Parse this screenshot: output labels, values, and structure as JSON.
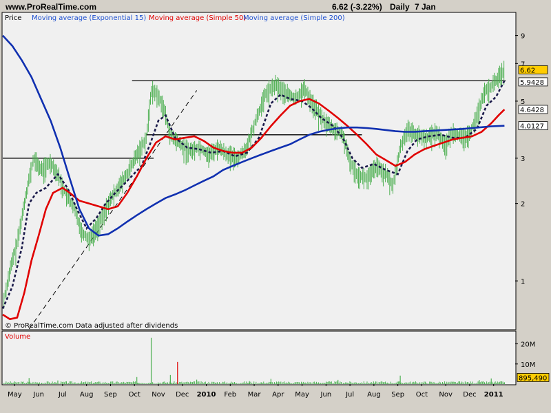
{
  "header": {
    "site": "www.ProRealTime.com",
    "quote": "6.62 (-3.22%)",
    "period": "Daily",
    "date": "7 Jan"
  },
  "legend": {
    "price": "Price",
    "ema": "Moving average (Exponential 15)",
    "sma50": "Moving average (Simple 50)",
    "sma200": "Moving average (Simple 200)"
  },
  "footnote": "© ProRealTime.com  Data adjusted after dividends",
  "volume_label": "Volume",
  "colors": {
    "background": "#d4d0c8",
    "plot_bg": "#f0f0f0",
    "price_bars": "#4caf50",
    "ema": "#1a1a4a",
    "sma50": "#e00000",
    "sma200": "#1030b0",
    "legend_ema": "#1e50d0",
    "label_bg_price": "#ffcc00",
    "label_box_border": "#000000"
  },
  "chart_data": [
    {
      "type": "line",
      "scale": "log",
      "ylim": [
        0.65,
        11
      ],
      "y_ticks": [
        1,
        2,
        3,
        5,
        7,
        9
      ],
      "grid": false,
      "x_labels": [
        "May",
        "Jun",
        "Jul",
        "Aug",
        "Sep",
        "Oct",
        "Nov",
        "Dec",
        "2010",
        "Feb",
        "Mar",
        "Apr",
        "May",
        "Jun",
        "Jul",
        "Aug",
        "Sep",
        "Oct",
        "Nov",
        "Dec",
        "2011"
      ],
      "x_positions": [
        0.5,
        1.5,
        2.5,
        3.5,
        4.5,
        5.5,
        6.5,
        7.5,
        8.5,
        9.5,
        10.5,
        11.5,
        12.5,
        13.5,
        14.5,
        15.5,
        16.5,
        17.5,
        18.5,
        19.5,
        20.5
      ],
      "x_max": 21.4,
      "series": [
        {
          "name": "Price",
          "role": "price",
          "values": [
            [
              0,
              0.8
            ],
            [
              0.3,
              1.1
            ],
            [
              0.6,
              1.4
            ],
            [
              0.9,
              2.0
            ],
            [
              1.1,
              2.5
            ],
            [
              1.3,
              3.0
            ],
            [
              1.6,
              2.7
            ],
            [
              2.0,
              2.9
            ],
            [
              2.3,
              2.6
            ],
            [
              2.6,
              2.2
            ],
            [
              3.0,
              1.9
            ],
            [
              3.3,
              1.55
            ],
            [
              3.6,
              1.45
            ],
            [
              4.0,
              1.65
            ],
            [
              4.4,
              2.0
            ],
            [
              4.8,
              2.3
            ],
            [
              5.2,
              2.6
            ],
            [
              5.6,
              3.1
            ],
            [
              6.0,
              3.6
            ],
            [
              6.2,
              5.5
            ],
            [
              6.4,
              5.4
            ],
            [
              6.7,
              4.8
            ],
            [
              7.0,
              3.7
            ],
            [
              7.4,
              3.4
            ],
            [
              7.8,
              3.2
            ],
            [
              8.2,
              3.3
            ],
            [
              8.6,
              3.1
            ],
            [
              9.0,
              3.3
            ],
            [
              9.4,
              3.1
            ],
            [
              9.8,
              3.0
            ],
            [
              10.2,
              3.3
            ],
            [
              10.6,
              4.3
            ],
            [
              11.0,
              5.4
            ],
            [
              11.4,
              5.8
            ],
            [
              11.8,
              5.4
            ],
            [
              12.2,
              5.1
            ],
            [
              12.6,
              5.6
            ],
            [
              13.0,
              4.8
            ],
            [
              13.4,
              4.2
            ],
            [
              13.8,
              3.9
            ],
            [
              14.2,
              3.7
            ],
            [
              14.5,
              2.9
            ],
            [
              14.8,
              2.6
            ],
            [
              15.2,
              2.5
            ],
            [
              15.6,
              2.8
            ],
            [
              16.0,
              2.6
            ],
            [
              16.3,
              2.35
            ],
            [
              16.6,
              3.3
            ],
            [
              16.9,
              3.9
            ],
            [
              17.3,
              3.7
            ],
            [
              17.7,
              3.6
            ],
            [
              18.1,
              3.8
            ],
            [
              18.5,
              3.4
            ],
            [
              18.8,
              3.8
            ],
            [
              19.2,
              3.6
            ],
            [
              19.5,
              3.7
            ],
            [
              19.8,
              4.4
            ],
            [
              20.1,
              5.4
            ],
            [
              20.4,
              5.7
            ],
            [
              20.7,
              6.2
            ],
            [
              20.95,
              6.62
            ]
          ]
        },
        {
          "name": "Moving average (Exponential 15)",
          "role": "ema",
          "values": [
            [
              0,
              0.78
            ],
            [
              0.4,
              0.95
            ],
            [
              0.8,
              1.35
            ],
            [
              1.1,
              2.0
            ],
            [
              1.4,
              2.2
            ],
            [
              1.8,
              2.3
            ],
            [
              2.3,
              2.6
            ],
            [
              2.7,
              2.3
            ],
            [
              3.1,
              1.9
            ],
            [
              3.5,
              1.6
            ],
            [
              3.9,
              1.75
            ],
            [
              4.3,
              2.0
            ],
            [
              4.7,
              2.2
            ],
            [
              5.2,
              2.45
            ],
            [
              5.8,
              2.8
            ],
            [
              6.2,
              3.5
            ],
            [
              6.5,
              4.2
            ],
            [
              6.8,
              4.4
            ],
            [
              7.2,
              3.6
            ],
            [
              7.7,
              3.3
            ],
            [
              8.2,
              3.25
            ],
            [
              8.7,
              3.15
            ],
            [
              9.2,
              3.2
            ],
            [
              9.7,
              3.05
            ],
            [
              10.2,
              3.15
            ],
            [
              10.7,
              3.6
            ],
            [
              11.2,
              4.9
            ],
            [
              11.6,
              5.3
            ],
            [
              12.0,
              5.1
            ],
            [
              12.5,
              5.0
            ],
            [
              12.9,
              4.7
            ],
            [
              13.3,
              4.3
            ],
            [
              13.8,
              4.0
            ],
            [
              14.2,
              3.6
            ],
            [
              14.6,
              3.0
            ],
            [
              15.0,
              2.75
            ],
            [
              15.5,
              2.85
            ],
            [
              16.0,
              2.7
            ],
            [
              16.5,
              2.6
            ],
            [
              16.9,
              3.2
            ],
            [
              17.3,
              3.55
            ],
            [
              17.8,
              3.65
            ],
            [
              18.3,
              3.7
            ],
            [
              18.8,
              3.6
            ],
            [
              19.3,
              3.6
            ],
            [
              19.8,
              3.9
            ],
            [
              20.2,
              4.8
            ],
            [
              20.6,
              5.2
            ],
            [
              20.95,
              6.0
            ]
          ]
        },
        {
          "name": "Moving average (Simple 50)",
          "role": "sma50",
          "values": [
            [
              0,
              0.74
            ],
            [
              0.3,
              0.71
            ],
            [
              0.6,
              0.72
            ],
            [
              0.9,
              0.9
            ],
            [
              1.2,
              1.2
            ],
            [
              1.5,
              1.5
            ],
            [
              1.8,
              1.9
            ],
            [
              2.1,
              2.2
            ],
            [
              2.5,
              2.3
            ],
            [
              2.8,
              2.2
            ],
            [
              3.2,
              2.05
            ],
            [
              3.6,
              2.0
            ],
            [
              4.0,
              1.95
            ],
            [
              4.4,
              1.9
            ],
            [
              4.8,
              1.95
            ],
            [
              5.2,
              2.2
            ],
            [
              5.6,
              2.55
            ],
            [
              6.0,
              3.0
            ],
            [
              6.4,
              3.45
            ],
            [
              6.8,
              3.65
            ],
            [
              7.2,
              3.55
            ],
            [
              7.6,
              3.6
            ],
            [
              8.0,
              3.65
            ],
            [
              8.4,
              3.5
            ],
            [
              8.8,
              3.3
            ],
            [
              9.2,
              3.2
            ],
            [
              9.6,
              3.15
            ],
            [
              10.0,
              3.15
            ],
            [
              10.4,
              3.3
            ],
            [
              10.8,
              3.6
            ],
            [
              11.2,
              4.0
            ],
            [
              11.6,
              4.4
            ],
            [
              12.0,
              4.8
            ],
            [
              12.4,
              5.0
            ],
            [
              12.8,
              5.1
            ],
            [
              13.2,
              4.9
            ],
            [
              13.6,
              4.6
            ],
            [
              14.0,
              4.3
            ],
            [
              14.4,
              4.0
            ],
            [
              14.8,
              3.7
            ],
            [
              15.2,
              3.4
            ],
            [
              15.6,
              3.1
            ],
            [
              16.0,
              2.95
            ],
            [
              16.4,
              2.8
            ],
            [
              16.8,
              2.9
            ],
            [
              17.2,
              3.1
            ],
            [
              17.6,
              3.25
            ],
            [
              18.0,
              3.35
            ],
            [
              18.4,
              3.45
            ],
            [
              18.8,
              3.55
            ],
            [
              19.2,
              3.6
            ],
            [
              19.6,
              3.65
            ],
            [
              20.0,
              3.8
            ],
            [
              20.4,
              4.1
            ],
            [
              20.7,
              4.4
            ],
            [
              20.95,
              4.64
            ]
          ]
        },
        {
          "name": "Moving average (Simple 200)",
          "role": "sma200",
          "values": [
            [
              0,
              9.0
            ],
            [
              0.4,
              8.2
            ],
            [
              0.8,
              7.2
            ],
            [
              1.2,
              6.2
            ],
            [
              1.6,
              5.1
            ],
            [
              2.0,
              4.2
            ],
            [
              2.4,
              3.3
            ],
            [
              2.8,
              2.5
            ],
            [
              3.2,
              1.9
            ],
            [
              3.6,
              1.6
            ],
            [
              4.0,
              1.5
            ],
            [
              4.4,
              1.52
            ],
            [
              4.8,
              1.6
            ],
            [
              5.2,
              1.7
            ],
            [
              5.6,
              1.8
            ],
            [
              6.0,
              1.9
            ],
            [
              6.4,
              2.0
            ],
            [
              6.8,
              2.1
            ],
            [
              7.2,
              2.17
            ],
            [
              7.6,
              2.25
            ],
            [
              8.0,
              2.35
            ],
            [
              8.4,
              2.45
            ],
            [
              8.8,
              2.55
            ],
            [
              9.2,
              2.7
            ],
            [
              9.6,
              2.8
            ],
            [
              10.0,
              2.9
            ],
            [
              10.4,
              3.0
            ],
            [
              10.8,
              3.1
            ],
            [
              11.2,
              3.2
            ],
            [
              11.6,
              3.3
            ],
            [
              12.0,
              3.4
            ],
            [
              12.4,
              3.55
            ],
            [
              12.8,
              3.7
            ],
            [
              13.2,
              3.8
            ],
            [
              13.6,
              3.87
            ],
            [
              14.0,
              3.92
            ],
            [
              14.4,
              3.95
            ],
            [
              14.8,
              3.95
            ],
            [
              15.2,
              3.93
            ],
            [
              15.6,
              3.9
            ],
            [
              16.0,
              3.86
            ],
            [
              16.4,
              3.82
            ],
            [
              16.8,
              3.8
            ],
            [
              17.2,
              3.8
            ],
            [
              17.6,
              3.82
            ],
            [
              18.0,
              3.84
            ],
            [
              18.4,
              3.86
            ],
            [
              18.8,
              3.88
            ],
            [
              19.2,
              3.9
            ],
            [
              19.6,
              3.93
            ],
            [
              20.0,
              3.96
            ],
            [
              20.4,
              3.99
            ],
            [
              20.95,
              4.01
            ]
          ]
        }
      ],
      "trend_lines": [
        {
          "x1": 0,
          "y1": 3.0,
          "x2": 6.3,
          "y2": 3.0,
          "style": "solid"
        },
        {
          "x1": 5.4,
          "y1": 6.0,
          "x2": 21.0,
          "y2": 6.0,
          "style": "solid"
        },
        {
          "x1": 6.0,
          "y1": 3.7,
          "x2": 15.0,
          "y2": 3.7,
          "style": "solid"
        },
        {
          "x1": 1.1,
          "y1": 0.65,
          "x2": 8.1,
          "y2": 5.5,
          "style": "dashed"
        }
      ],
      "value_labels": [
        {
          "text": "6.62",
          "value": 6.62,
          "highlight": true
        },
        {
          "text": "5.9428",
          "value": 5.9428,
          "highlight": false
        },
        {
          "text": "4.6428",
          "value": 4.6428,
          "highlight": false
        },
        {
          "text": "4.0127",
          "value": 4.0127,
          "highlight": false
        }
      ]
    },
    {
      "type": "bar",
      "name": "Volume",
      "y_ticks_labels": [
        "20M",
        "10M"
      ],
      "y_ticks": [
        20000000,
        10000000
      ],
      "ylim": [
        0,
        26000000
      ],
      "last_value_label": "895,490",
      "spikes": [
        [
          1.1,
          3000000
        ],
        [
          2.3,
          1800000
        ],
        [
          5.6,
          3500000
        ],
        [
          6.2,
          23000000
        ],
        [
          7.0,
          4500000
        ],
        [
          7.3,
          11000000
        ],
        [
          8.1,
          2200000
        ],
        [
          10.3,
          1500000
        ],
        [
          11.2,
          2600000
        ],
        [
          14.0,
          2100000
        ],
        [
          16.6,
          4200000
        ],
        [
          19.9,
          2000000
        ],
        [
          20.4,
          2800000
        ],
        [
          20.95,
          895490
        ]
      ]
    }
  ]
}
